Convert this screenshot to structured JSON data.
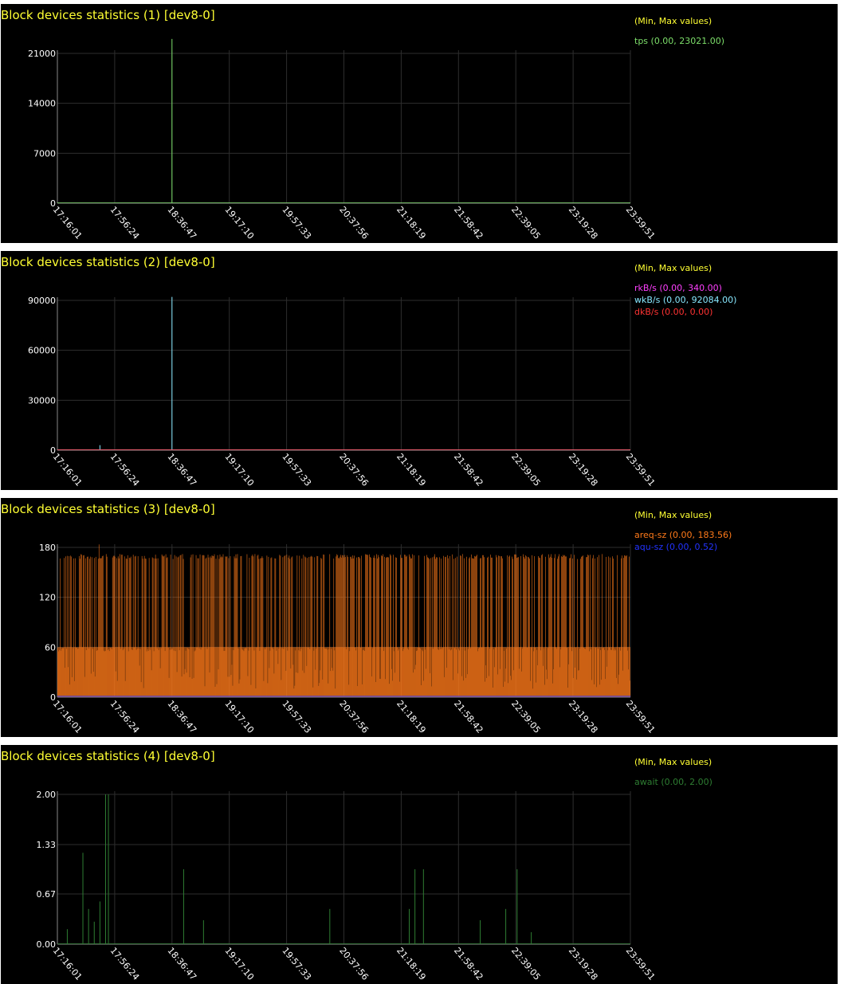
{
  "legend_header": "(Min, Max values)",
  "x_ticks": [
    "17:16:01",
    "17:56:24",
    "18:36:47",
    "19:17:10",
    "19:57:33",
    "20:37:56",
    "21:18:19",
    "21:58:42",
    "22:39:05",
    "23:19:28",
    "23:59:51"
  ],
  "chart_data": [
    {
      "type": "line",
      "title": "Block devices statistics (1) [dev8-0]",
      "ylim": [
        0,
        23021
      ],
      "y_ticks": [
        "0",
        "7000",
        "14000",
        "21000"
      ],
      "y_tick_values": [
        0,
        7000,
        14000,
        21000
      ],
      "x_ticks": [
        "17:16:01",
        "17:56:24",
        "18:36:47",
        "19:17:10",
        "19:57:33",
        "20:37:56",
        "21:18:19",
        "21:58:42",
        "22:39:05",
        "23:19:28",
        "23:59:51"
      ],
      "series": [
        {
          "name": "tps (0.00, 23021.00)",
          "color": "#7ddf6a",
          "x": [
            "18:36:47",
            "18:36:47"
          ],
          "y": [
            0,
            23021
          ],
          "baseline": 130
        }
      ],
      "grid": true,
      "legend_position": "right"
    },
    {
      "type": "line",
      "title": "Block devices statistics (2) [dev8-0]",
      "ylim": [
        0,
        92084
      ],
      "y_ticks": [
        "0",
        "30000",
        "60000",
        "90000"
      ],
      "y_tick_values": [
        0,
        30000,
        60000,
        90000
      ],
      "x_ticks": [
        "17:16:01",
        "17:56:24",
        "18:36:47",
        "19:17:10",
        "19:57:33",
        "20:37:56",
        "21:18:19",
        "21:58:42",
        "22:39:05",
        "23:19:28",
        "23:59:51"
      ],
      "series": [
        {
          "name": "rkB/s (0.00, 340.00)",
          "color": "#ff40ff",
          "x": [
            "17:45:00"
          ],
          "y": [
            340
          ],
          "baseline": 0
        },
        {
          "name": "wkB/s (0.00, 92084.00)",
          "color": "#88e8ff",
          "x": [
            "18:36:47"
          ],
          "y": [
            92084
          ],
          "baseline": 300,
          "extra_x": [
            "17:46:00"
          ],
          "extra_y": [
            3000
          ]
        },
        {
          "name": "dkB/s (0.00, 0.00)",
          "color": "#ff3333",
          "x": [],
          "y": [],
          "baseline": 0
        }
      ],
      "grid": true,
      "legend_position": "right"
    },
    {
      "type": "area",
      "title": "Block devices statistics (3) [dev8-0]",
      "ylim": [
        0,
        183.56
      ],
      "y_ticks": [
        "0",
        "60",
        "120",
        "180"
      ],
      "y_tick_values": [
        0,
        60,
        120,
        180
      ],
      "x_ticks": [
        "17:16:01",
        "17:56:24",
        "18:36:47",
        "19:17:10",
        "19:57:33",
        "20:37:56",
        "21:18:19",
        "21:58:42",
        "22:39:05",
        "23:19:28",
        "23:59:51"
      ],
      "series": [
        {
          "name": "areq-sz (0.00, 183.56)",
          "color": "#ff7a1a",
          "typical_max": 172,
          "peak": 183.56,
          "mid_band": 60
        },
        {
          "name": "aqu-sz (0.00, 0.52)",
          "color": "#2233ff",
          "typical_max": 0.52
        }
      ],
      "grid": true,
      "legend_position": "right"
    },
    {
      "type": "line",
      "title": "Block devices statistics (4) [dev8-0]",
      "ylim": [
        0,
        2.0
      ],
      "y_ticks": [
        "0.00",
        "0.67",
        "1.33",
        "2.00"
      ],
      "y_tick_values": [
        0,
        0.67,
        1.33,
        2.0
      ],
      "x_ticks": [
        "17:16:01",
        "17:56:24",
        "18:36:47",
        "19:17:10",
        "19:57:33",
        "20:37:56",
        "21:18:19",
        "21:58:42",
        "22:39:05",
        "23:19:28",
        "23:59:51"
      ],
      "series": [
        {
          "name": "await (0.00, 2.00)",
          "color": "#2e7d32",
          "x": [
            "17:23:00",
            "17:34:00",
            "17:38:00",
            "17:42:00",
            "17:46:00",
            "17:50:00",
            "17:52:00",
            "18:45:00",
            "18:59:00",
            "20:28:00",
            "21:24:00",
            "21:28:00",
            "21:34:00",
            "22:14:00",
            "22:32:00",
            "22:40:00",
            "22:50:00"
          ],
          "y": [
            0.2,
            1.22,
            0.47,
            0.3,
            0.57,
            2.0,
            2.0,
            1.0,
            0.32,
            0.47,
            0.47,
            1.0,
            1.0,
            0.32,
            0.47,
            1.0,
            0.16
          ]
        }
      ],
      "grid": true,
      "legend_position": "right"
    }
  ]
}
